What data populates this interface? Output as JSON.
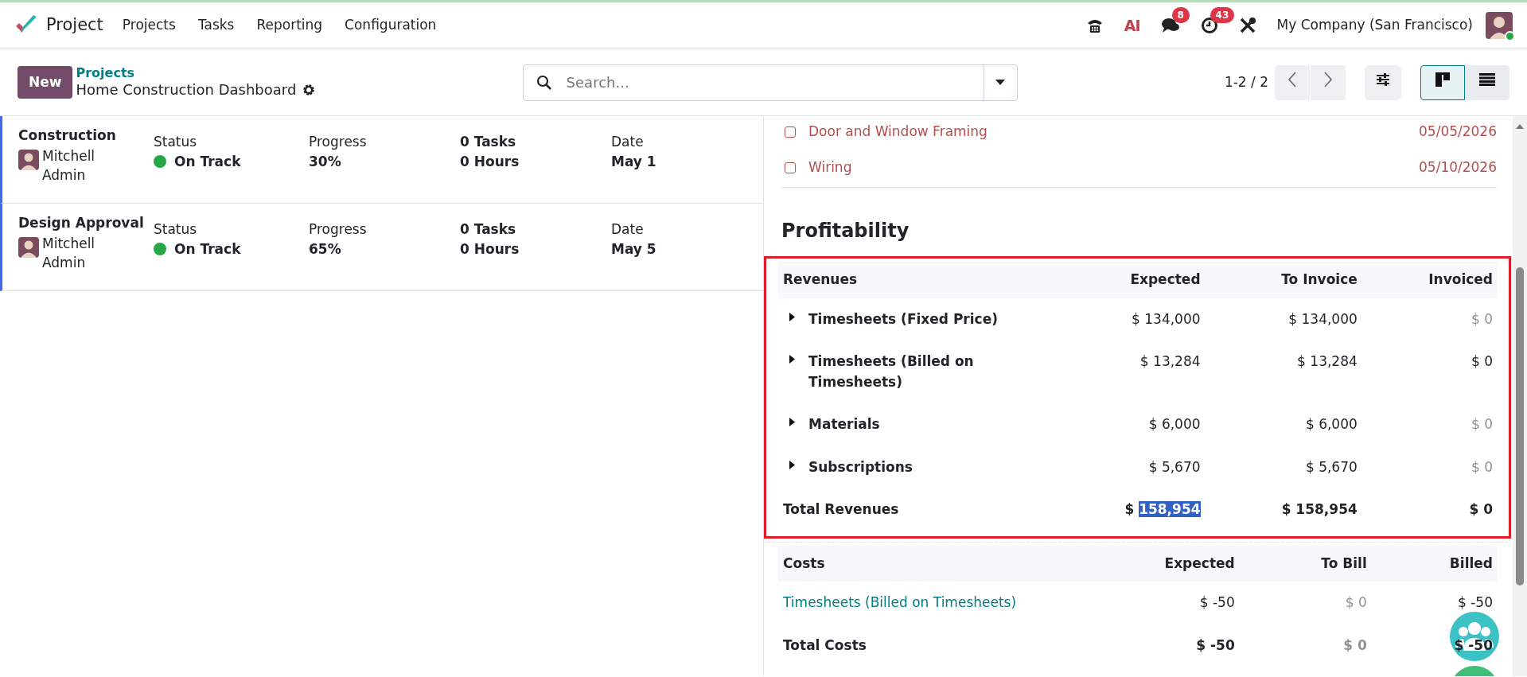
{
  "navbar": {
    "app": "Project",
    "menu": [
      "Projects",
      "Tasks",
      "Reporting",
      "Configuration"
    ],
    "ai_label": "AI",
    "messages_count": "8",
    "activities_count": "43",
    "company": "My Company (San Francisco)",
    "user_online": true
  },
  "control_panel": {
    "new_button": "New",
    "breadcrumb": "Projects",
    "title": "Home Construction Dashboard",
    "search": {
      "placeholder": "Search..."
    },
    "pager": "1-2 / 2",
    "views": [
      {
        "kind": "kanban",
        "selected": true
      },
      {
        "kind": "list",
        "selected": false
      }
    ]
  },
  "projects": [
    {
      "name": "Construction",
      "manager": "Mitchell Admin",
      "status_label": "Status",
      "status": "On Track",
      "color": "#28a745",
      "progress_label": "Progress",
      "progress": "30%",
      "tasks": "0 Tasks",
      "hours": "0 Hours",
      "date_label": "Date",
      "date": "May 1"
    },
    {
      "name": "Design Approval",
      "manager": "Mitchell Admin",
      "status_label": "Status",
      "status": "On Track",
      "color": "#28a745",
      "progress_label": "Progress",
      "progress": "65%",
      "tasks": "0 Tasks",
      "hours": "0 Hours",
      "date_label": "Date",
      "date": "May 5"
    }
  ],
  "tasks": [
    {
      "name": "Door and Window Framing",
      "date": "05/05/2026",
      "checked": false,
      "overdue": true
    },
    {
      "name": "Wiring",
      "date": "05/10/2026",
      "checked": false,
      "overdue": true
    }
  ],
  "profitability": {
    "title": "Profitability",
    "revenues": {
      "highlighted": true,
      "headers": [
        "Revenues",
        "Expected",
        "To Invoice",
        "Invoiced"
      ],
      "rows": [
        {
          "label": "Timesheets (Fixed Price)",
          "expandable": true,
          "link": false,
          "cells": [
            {
              "text": "$ 134,000",
              "muted": false
            },
            {
              "text": "$ 134,000",
              "muted": false
            },
            {
              "text": "$ 0",
              "muted": true
            }
          ]
        },
        {
          "label": "Timesheets (Billed on Timesheets)",
          "expandable": true,
          "link": false,
          "cells": [
            {
              "text": "$ 13,284",
              "muted": false
            },
            {
              "text": "$ 13,284",
              "muted": false
            },
            {
              "text": "$ 0",
              "muted": false
            }
          ]
        },
        {
          "label": "Materials",
          "expandable": true,
          "link": false,
          "cells": [
            {
              "text": "$ 6,000",
              "muted": false
            },
            {
              "text": "$ 6,000",
              "muted": false
            },
            {
              "text": "$ 0",
              "muted": true
            }
          ]
        },
        {
          "label": "Subscriptions",
          "expandable": true,
          "link": false,
          "cells": [
            {
              "text": "$ 5,670",
              "muted": false
            },
            {
              "text": "$ 5,670",
              "muted": false
            },
            {
              "text": "$ 0",
              "muted": true
            }
          ]
        }
      ],
      "total": {
        "label": "Total Revenues",
        "cells": [
          {
            "text": "$ 158,954",
            "muted": false,
            "selected": true
          },
          {
            "text": "$ 158,954",
            "muted": false,
            "selected": false
          },
          {
            "text": "$ 0",
            "muted": false,
            "selected": false
          }
        ]
      }
    },
    "costs": {
      "highlighted": false,
      "headers": [
        "Costs",
        "Expected",
        "To Bill",
        "Billed"
      ],
      "rows": [
        {
          "label": "Timesheets (Billed on Timesheets)",
          "expandable": false,
          "link": true,
          "cells": [
            {
              "text": "$ -50",
              "muted": false
            },
            {
              "text": "$ 0",
              "muted": true
            },
            {
              "text": "$ -50",
              "muted": false
            }
          ]
        }
      ],
      "total": {
        "label": "Total Costs",
        "cells": [
          {
            "text": "$ -50",
            "muted": false,
            "selected": false
          },
          {
            "text": "$ 0",
            "muted": true,
            "selected": false
          },
          {
            "text": "$ -50",
            "muted": false,
            "selected": false
          }
        ]
      }
    }
  }
}
